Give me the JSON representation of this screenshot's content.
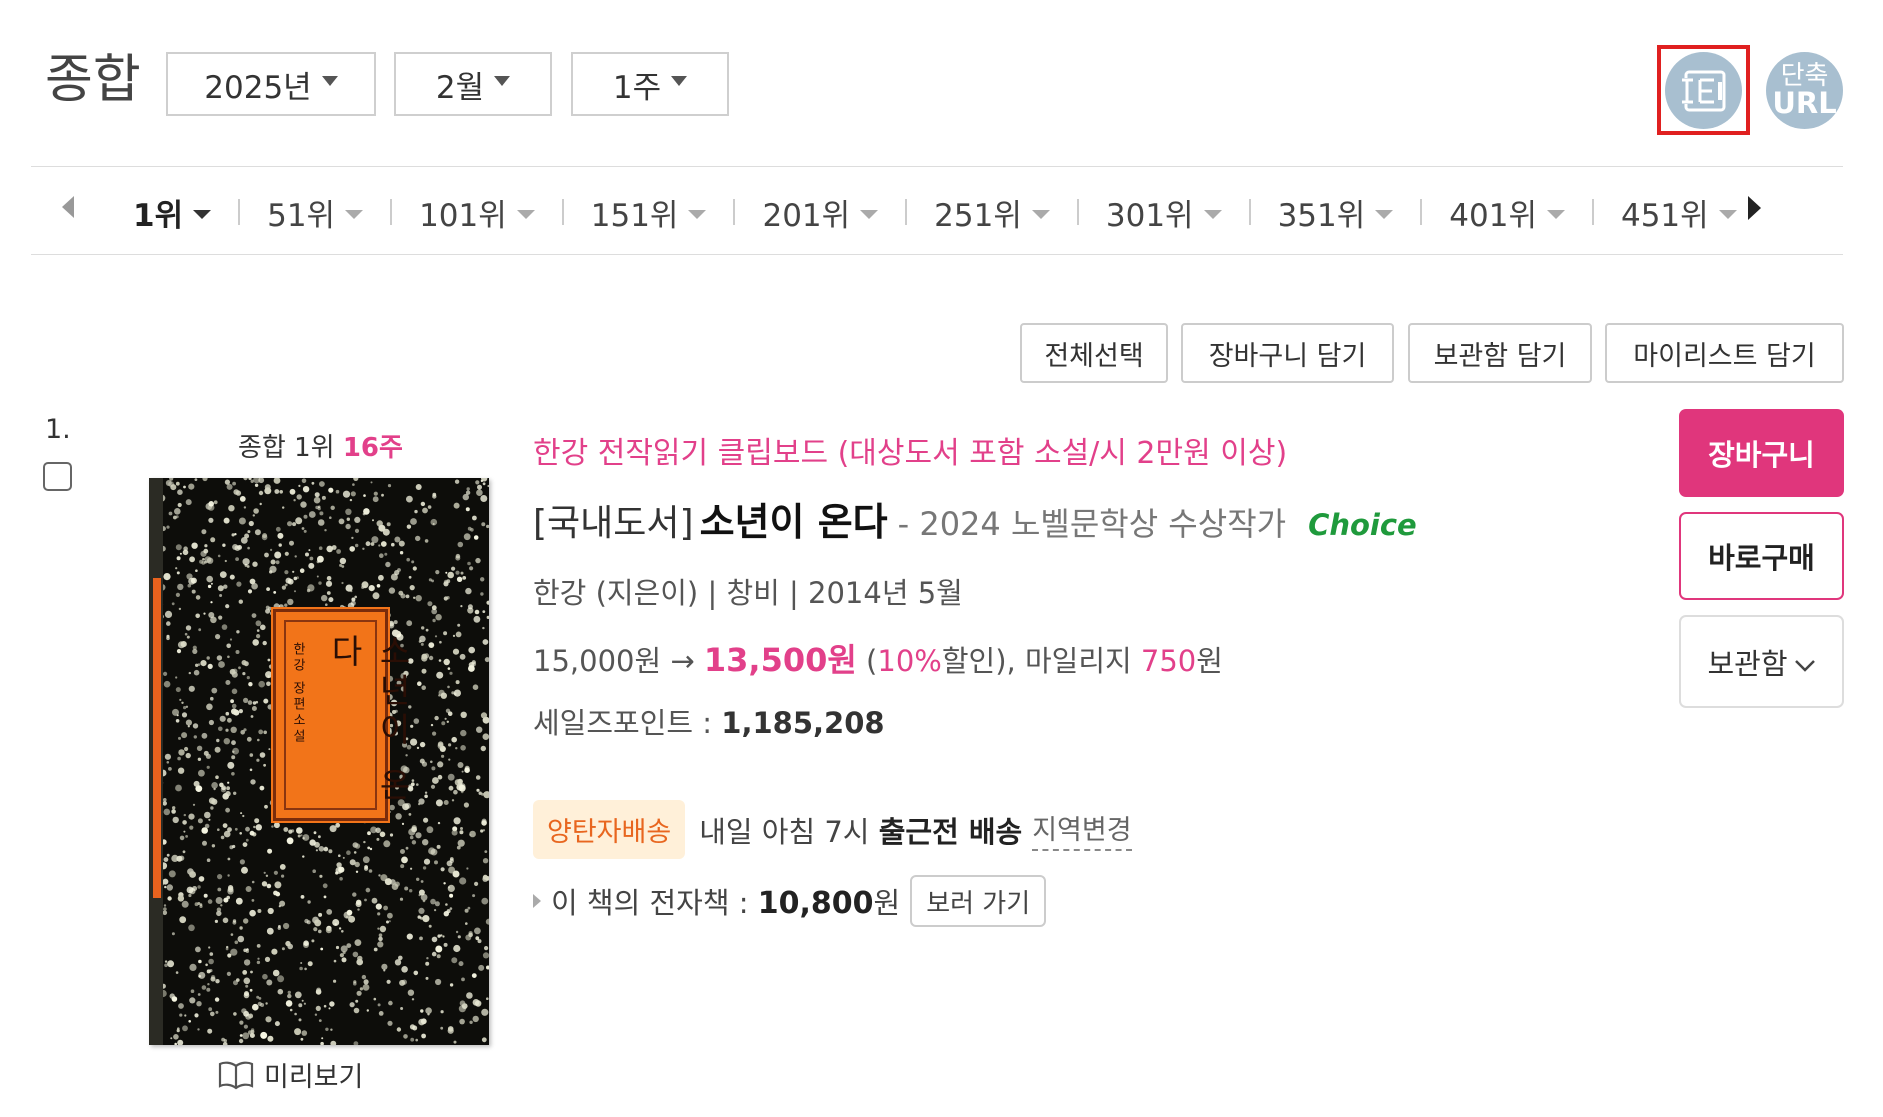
{
  "header": {
    "title": "종합",
    "year": "2025년",
    "month": "2월",
    "week": "1주",
    "share_icon": "share-icon",
    "url_button": {
      "line1": "단축",
      "line2": "URL"
    }
  },
  "rank_nav": {
    "items": [
      "1위",
      "51위",
      "101위",
      "151위",
      "201위",
      "251위",
      "301위",
      "351위",
      "401위",
      "451위"
    ],
    "active_index": 0
  },
  "actions": {
    "select_all": "전체선택",
    "add_cart": "장바구니 담기",
    "add_storage": "보관함 담기",
    "add_mylist": "마이리스트 담기"
  },
  "item": {
    "number": "1.",
    "rank_badge_prefix": "종합 1위",
    "rank_badge_weeks": "16주",
    "cover": {
      "title": "소년이 온다",
      "subtitle": "한강 장편소설"
    },
    "preview_label": "미리보기",
    "promo": "한강 전작읽기 클립보드 (대상도서 포함 소설/시 2만원 이상)",
    "category": "[국내도서]",
    "title": "소년이 온다",
    "subtitle": "- 2024 노벨문학상 수상작가",
    "choice": "Choice",
    "author_line": "한강 (지은이) | 창비 | 2014년 5월",
    "price": {
      "list_price": "15,000원 →",
      "sale_price": "13,500원",
      "open_paren": "(",
      "discount_pct": "10%",
      "discount_word": "할인), 마일리지",
      "mileage": "750",
      "won": "원"
    },
    "points_label": "세일즈포인트 :",
    "points_value": "1,185,208",
    "delivery": {
      "badge": "양탄자배송",
      "text_prefix": "내일 아침 7시",
      "text_bold": "출근전 배송",
      "region": "지역변경"
    },
    "ebook": {
      "label": "이 책의 전자책 :",
      "price": "10,800",
      "won": "원",
      "button": "보러 가기"
    }
  },
  "side_buttons": {
    "cart": "장바구니",
    "buy": "바로구매",
    "save": "보관함"
  },
  "colors": {
    "accent_pink": "#e0367c",
    "choice_green": "#1f9a3c",
    "badge_orange": "#e8661f",
    "share_highlight": "#e02020"
  }
}
